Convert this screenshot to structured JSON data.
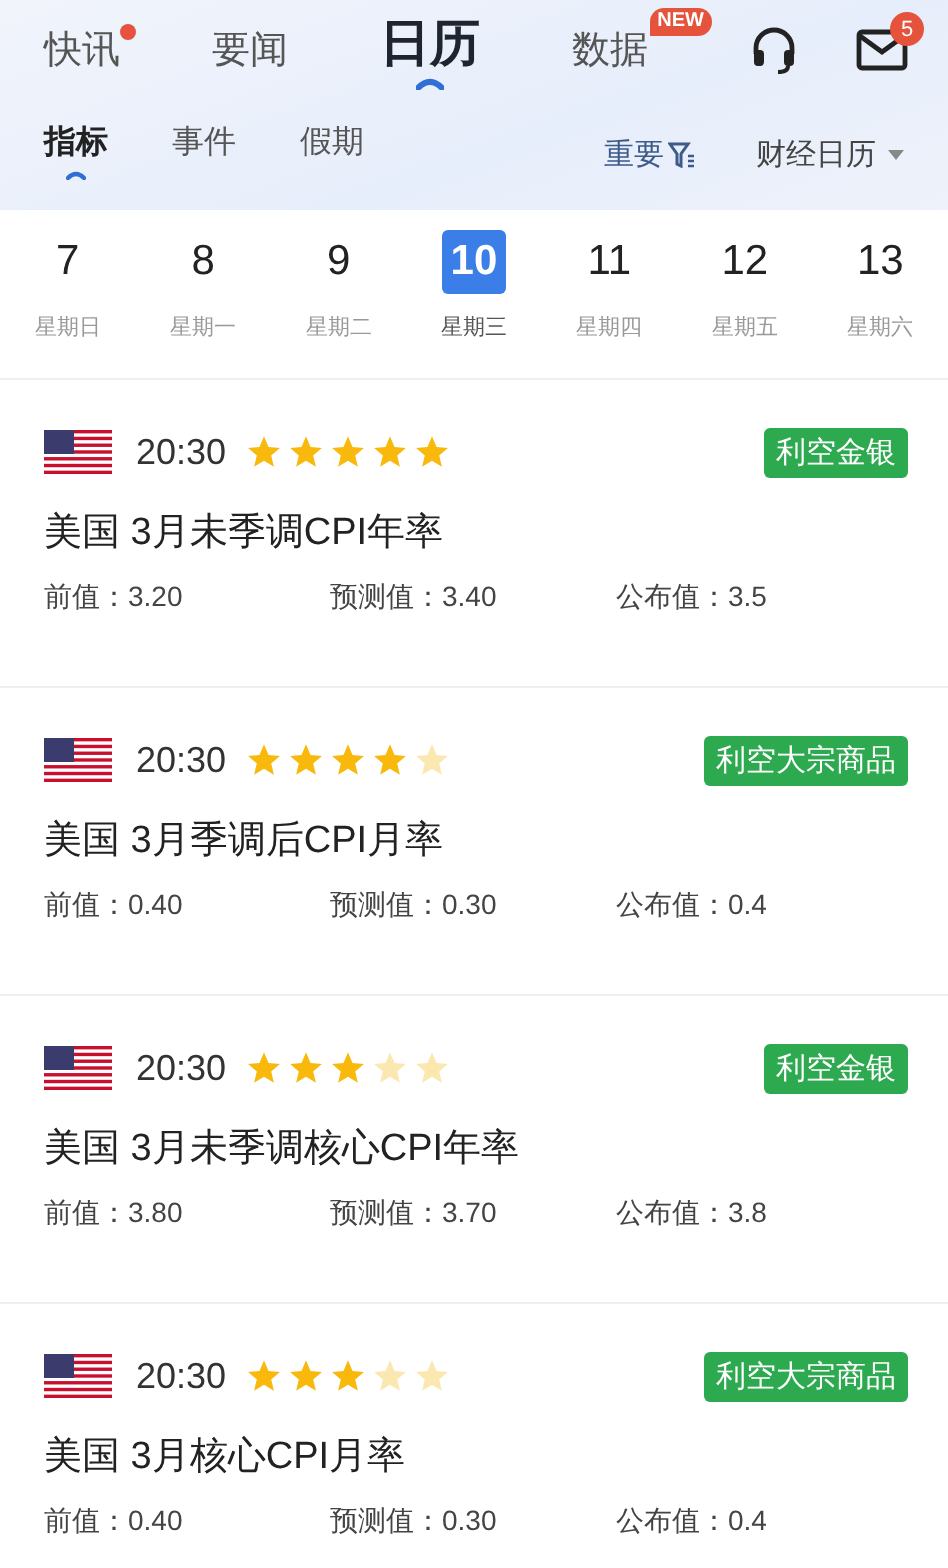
{
  "top_tabs": [
    {
      "label": "快讯",
      "selected": false,
      "dot": true
    },
    {
      "label": "要闻",
      "selected": false,
      "dot": false
    },
    {
      "label": "日历",
      "selected": true,
      "dot": false
    },
    {
      "label": "数据",
      "selected": false,
      "dot": false,
      "badge": "NEW"
    }
  ],
  "mail_badge": "5",
  "sub_tabs": [
    {
      "label": "指标",
      "selected": true
    },
    {
      "label": "事件",
      "selected": false
    },
    {
      "label": "假期",
      "selected": false
    }
  ],
  "filter": {
    "label": "重要"
  },
  "calendar_dropdown": {
    "label": "财经日历"
  },
  "days": [
    {
      "date": "7",
      "weekday": "星期日",
      "selected": false
    },
    {
      "date": "8",
      "weekday": "星期一",
      "selected": false
    },
    {
      "date": "9",
      "weekday": "星期二",
      "selected": false
    },
    {
      "date": "10",
      "weekday": "星期三",
      "selected": true
    },
    {
      "date": "11",
      "weekday": "星期四",
      "selected": false
    },
    {
      "date": "12",
      "weekday": "星期五",
      "selected": false
    },
    {
      "date": "13",
      "weekday": "星期六",
      "selected": false
    }
  ],
  "events": [
    {
      "time": "20:30",
      "stars": 5,
      "tag": "利空金银",
      "title": "美国 3月未季调CPI年率",
      "previous": "前值：3.20",
      "forecast": "预测值：3.40",
      "actual": "公布值：3.5"
    },
    {
      "time": "20:30",
      "stars": 4,
      "tag": "利空大宗商品",
      "title": "美国 3月季调后CPI月率",
      "previous": "前值：0.40",
      "forecast": "预测值：0.30",
      "actual": "公布值：0.4"
    },
    {
      "time": "20:30",
      "stars": 3,
      "tag": "利空金银",
      "title": "美国 3月未季调核心CPI年率",
      "previous": "前值：3.80",
      "forecast": "预测值：3.70",
      "actual": "公布值：3.8"
    },
    {
      "time": "20:30",
      "stars": 3,
      "tag": "利空大宗商品",
      "title": "美国 3月核心CPI月率",
      "previous": "前值：0.40",
      "forecast": "预测值：0.30",
      "actual": "公布值：0.4"
    }
  ]
}
